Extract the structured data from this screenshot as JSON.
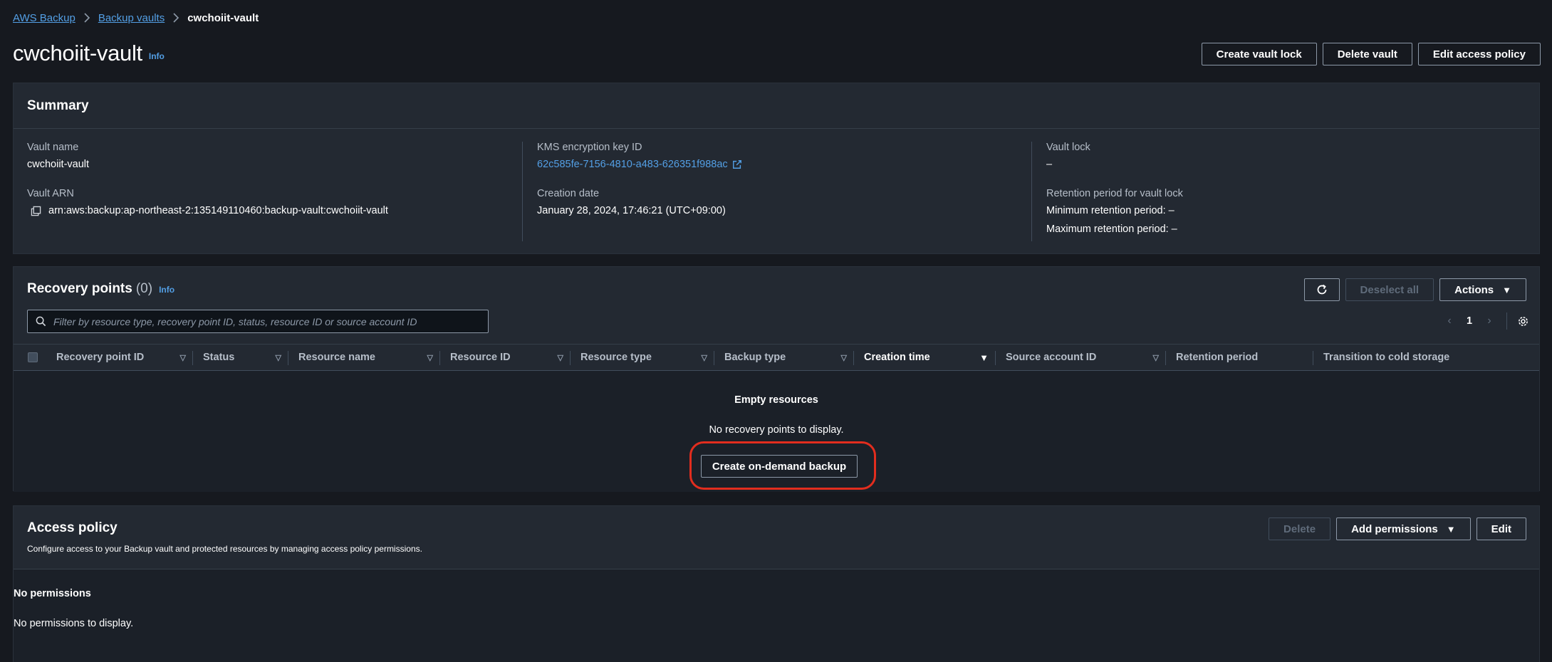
{
  "breadcrumb": {
    "items": [
      {
        "label": "AWS Backup"
      },
      {
        "label": "Backup vaults"
      }
    ],
    "current": "cwchoiit-vault"
  },
  "header": {
    "title": "cwchoiit-vault",
    "info": "Info",
    "buttons": {
      "create_vault_lock": "Create vault lock",
      "delete_vault": "Delete vault",
      "edit_access_policy": "Edit access policy"
    }
  },
  "summary": {
    "title": "Summary",
    "vault_name_label": "Vault name",
    "vault_name": "cwchoiit-vault",
    "vault_arn_label": "Vault ARN",
    "vault_arn": "arn:aws:backup:ap-northeast-2:135149110460:backup-vault:cwchoiit-vault",
    "kms_label": "KMS encryption key ID",
    "kms_value": "62c585fe-7156-4810-a483-626351f988ac",
    "creation_date_label": "Creation date",
    "creation_date": "January 28, 2024, 17:46:21 (UTC+09:00)",
    "vault_lock_label": "Vault lock",
    "vault_lock": "–",
    "retention_label": "Retention period for vault lock",
    "min_retention": "Minimum retention period: –",
    "max_retention": "Maximum retention period: –"
  },
  "recovery": {
    "title": "Recovery points",
    "count": "(0)",
    "info": "Info",
    "deselect_all": "Deselect all",
    "actions": "Actions",
    "search_placeholder": "Filter by resource type, recovery point ID, status, resource ID or source account ID",
    "page": "1",
    "columns": [
      "Recovery point ID",
      "Status",
      "Resource name",
      "Resource ID",
      "Resource type",
      "Backup type",
      "Creation time",
      "Source account ID",
      "Retention period",
      "Transition to cold storage"
    ],
    "empty_title": "Empty resources",
    "empty_desc": "No recovery points to display.",
    "empty_button": "Create on-demand backup"
  },
  "access_policy": {
    "title": "Access policy",
    "description": "Configure access to your Backup vault and protected resources by managing access policy permissions.",
    "delete": "Delete",
    "add_permissions": "Add permissions",
    "edit": "Edit",
    "empty_title": "No permissions",
    "empty_desc": "No permissions to display."
  },
  "colors": {
    "background": "#16191f",
    "panel": "#232932",
    "link": "#539fe5",
    "highlight": "#e22d1e"
  }
}
